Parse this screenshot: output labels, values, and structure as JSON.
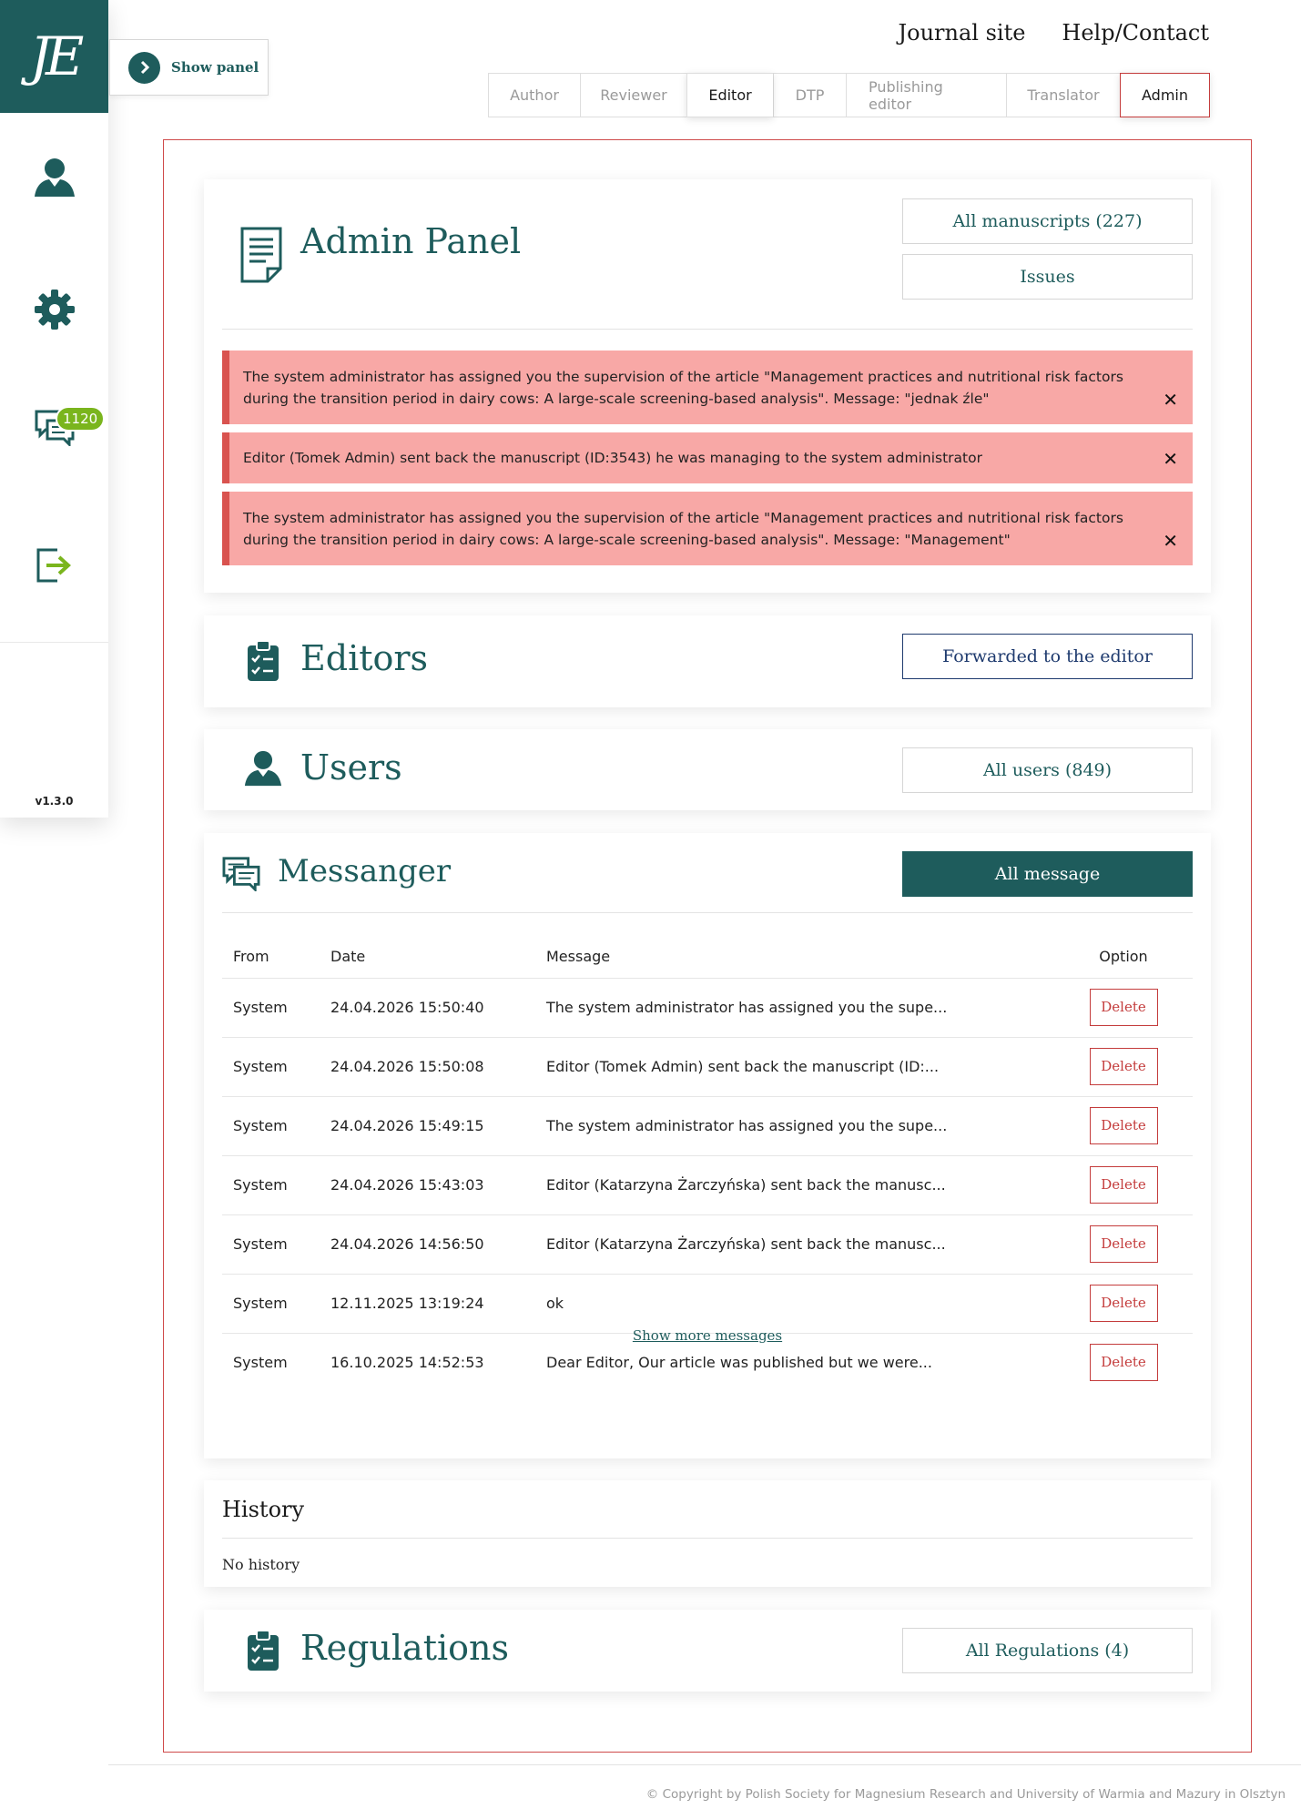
{
  "logo": {
    "text": "JE"
  },
  "sidebar": {
    "messages_badge": "1120",
    "version": "v1.3.0"
  },
  "show_panel": {
    "label": "Show panel"
  },
  "top_links": {
    "journal_site": "Journal site",
    "help_contact": "Help/Contact"
  },
  "roles": [
    {
      "label": "Author"
    },
    {
      "label": "Reviewer"
    },
    {
      "label": "Editor"
    },
    {
      "label": "DTP"
    },
    {
      "label": "Publishing editor"
    },
    {
      "label": "Translator"
    },
    {
      "label": "Admin"
    }
  ],
  "admin_panel": {
    "title": "Admin Panel",
    "all_manuscripts": "All manuscripts (227)",
    "issues": "Issues",
    "alerts": [
      {
        "text": "The system administrator has assigned you the supervision of the article \"Management practices and nutritional risk factors during the transition period in dairy cows: A large-scale screening-based analysis\". Message: \"jednak źle\""
      },
      {
        "text": "Editor (Tomek Admin) sent back the manuscript (ID:3543) he was managing to the system administrator"
      },
      {
        "text": "The system administrator has assigned you the supervision of the article \"Management practices and nutritional risk factors during the transition period in dairy cows: A large-scale screening-based analysis\". Message: \"Management\""
      }
    ],
    "close_symbol": "✕"
  },
  "editors": {
    "title": "Editors",
    "button": "Forwarded to the editor"
  },
  "users": {
    "title": "Users",
    "button": "All users (849)"
  },
  "messenger": {
    "title": "Messanger",
    "button": "All message",
    "columns": {
      "from": "From",
      "date": "Date",
      "message": "Message",
      "option": "Option"
    },
    "rows": [
      {
        "from": "System",
        "date": "24.04.2026 15:50:40",
        "message": "The system administrator has assigned you the supe...",
        "action": "Delete"
      },
      {
        "from": "System",
        "date": "24.04.2026 15:50:08",
        "message": "Editor (Tomek Admin) sent back the manuscript (ID:...",
        "action": "Delete"
      },
      {
        "from": "System",
        "date": "24.04.2026 15:49:15",
        "message": "The system administrator has assigned you the supe...",
        "action": "Delete"
      },
      {
        "from": "System",
        "date": "24.04.2026 15:43:03",
        "message": "Editor (Katarzyna Żarczyńska) sent back the manusc...",
        "action": "Delete"
      },
      {
        "from": "System",
        "date": "24.04.2026 14:56:50",
        "message": "Editor (Katarzyna Żarczyńska) sent back the manusc...",
        "action": "Delete"
      },
      {
        "from": "System",
        "date": "12.11.2025 13:19:24",
        "message": "ok",
        "action": "Delete"
      },
      {
        "from": "System",
        "date": "16.10.2025 14:52:53",
        "message": "Dear Editor, Our article was published but we were...",
        "action": "Delete"
      }
    ],
    "show_more": "Show more messages"
  },
  "history": {
    "title": "History",
    "empty": "No history"
  },
  "regulations": {
    "title": "Regulations",
    "button": "All Regulations (4)"
  },
  "footer": {
    "copyright": "© Copyright by Polish Society for Magnesium Research and University of Warmia and Mazury in Olsztyn"
  },
  "colors": {
    "primary": "#1e5c5c",
    "accent_red": "#c43c3c",
    "alert_bg": "#f8a8a6",
    "badge": "#7ab51d"
  }
}
